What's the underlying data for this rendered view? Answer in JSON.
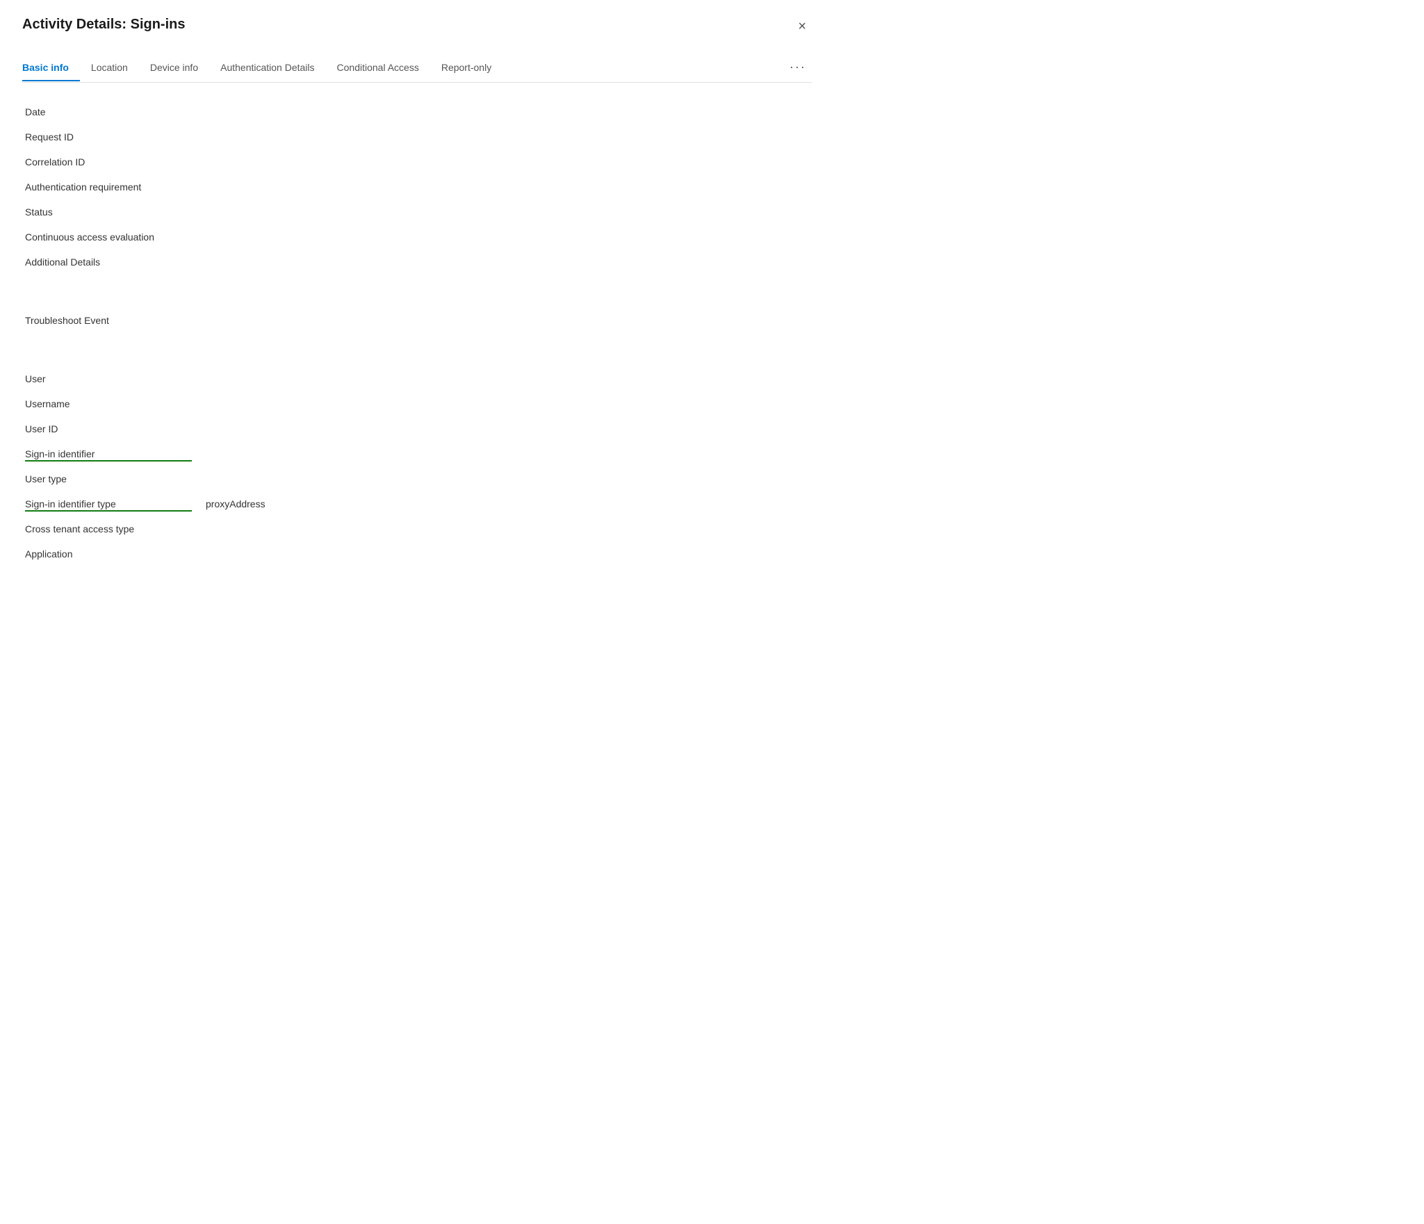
{
  "dialog": {
    "title": "Activity Details: Sign-ins",
    "close_label": "×"
  },
  "tabs": [
    {
      "id": "basic-info",
      "label": "Basic info",
      "active": true
    },
    {
      "id": "location",
      "label": "Location",
      "active": false
    },
    {
      "id": "device-info",
      "label": "Device info",
      "active": false
    },
    {
      "id": "authentication-details",
      "label": "Authentication Details",
      "active": false
    },
    {
      "id": "conditional-access",
      "label": "Conditional Access",
      "active": false
    },
    {
      "id": "report-only",
      "label": "Report-only",
      "active": false
    }
  ],
  "tab_more_label": "···",
  "fields_group1": [
    {
      "label": "Date",
      "value": "",
      "underlined": false
    },
    {
      "label": "Request ID",
      "value": "",
      "underlined": false
    },
    {
      "label": "Correlation ID",
      "value": "",
      "underlined": false
    },
    {
      "label": "Authentication requirement",
      "value": "",
      "underlined": false
    },
    {
      "label": "Status",
      "value": "",
      "underlined": false
    },
    {
      "label": "Continuous access evaluation",
      "value": "",
      "underlined": false
    },
    {
      "label": "Additional Details",
      "value": "",
      "underlined": false
    }
  ],
  "fields_group2": [
    {
      "label": "Troubleshoot Event",
      "value": "",
      "underlined": false
    }
  ],
  "fields_group3": [
    {
      "label": "User",
      "value": "",
      "underlined": false
    },
    {
      "label": "Username",
      "value": "",
      "underlined": false
    },
    {
      "label": "User ID",
      "value": "",
      "underlined": false
    },
    {
      "label": "Sign-in identifier",
      "value": "",
      "underlined": true
    },
    {
      "label": "User type",
      "value": "",
      "underlined": false
    },
    {
      "label": "Sign-in identifier type",
      "value": "proxyAddress",
      "underlined": true
    },
    {
      "label": "Cross tenant access type",
      "value": "",
      "underlined": false
    },
    {
      "label": "Application",
      "value": "",
      "underlined": false
    }
  ]
}
